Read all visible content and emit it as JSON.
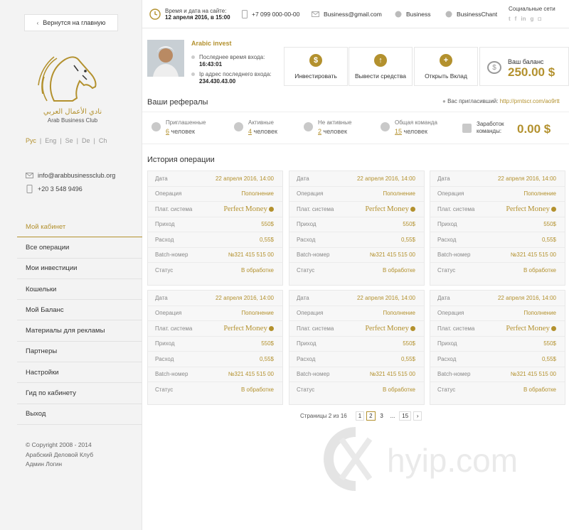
{
  "sidebar": {
    "back_label": "Вернутся на главную",
    "logo_text_ar": "نادي الأعمال العربي",
    "logo_text_en": "Arab Business Club",
    "languages": [
      "Рус",
      "Eng",
      "Se",
      "De",
      "Ch"
    ],
    "active_language": "Рус",
    "email": "info@arabbusinessclub.org",
    "phone": "+20 3 548 9496",
    "nav": [
      {
        "label": "Мой кабинет",
        "active": true
      },
      {
        "label": "Все операции"
      },
      {
        "label": "Мои инвестиции"
      },
      {
        "label": "Кошельки"
      },
      {
        "label": "Мой Баланс"
      },
      {
        "label": "Материалы для рекламы"
      },
      {
        "label": "Партнеры"
      },
      {
        "label": "Настройки"
      },
      {
        "label": "Гид по кабинету"
      },
      {
        "label": "Выход"
      }
    ],
    "copyright_line1": "© Copyright 2008 - 2014",
    "copyright_line2": "Арабский Деловой Клуб",
    "copyright_line3": "Админ Логин"
  },
  "topbar": {
    "datetime_label": "Время и дата на сайте:",
    "datetime_value": "12 апреля 2016, в 15:00",
    "phone": "+7 099 000-00-00",
    "email": "Business@gmail.com",
    "skype1": "Business",
    "skype2": "BusinessChant",
    "social_title": "Социальные сети",
    "social_icons": [
      "twitter-icon",
      "facebook-icon",
      "linkedin-icon",
      "google-icon",
      "instagram-icon"
    ]
  },
  "profile": {
    "name": "Arabic invest",
    "last_login_label": "Последнее время входа:",
    "last_login_value": "16:43:01",
    "ip_label": "Ip адрес последнего входа:",
    "ip_value": "234.430.43.00"
  },
  "actions": [
    {
      "label": "Инвестировать",
      "icon": "invest-icon"
    },
    {
      "label": "Вывести средства",
      "icon": "withdraw-icon"
    },
    {
      "label": "Открыть Вклад",
      "icon": "deposit-icon"
    }
  ],
  "balance": {
    "label": "Ваш баланс",
    "value": "250.00 $"
  },
  "referrals": {
    "title": "Ваши рефералы",
    "invited_by_label": "Вас пригласивший:",
    "invited_by_link": "http://prntscr.com/ao9rtt",
    "stats": [
      {
        "label": "Приглашенные",
        "count": "6",
        "unit": "человек"
      },
      {
        "label": "Активные",
        "count": "4",
        "unit": "человек"
      },
      {
        "label": "Не активные",
        "count": "2",
        "unit": "человек"
      },
      {
        "label": "Общая команда",
        "count": "15",
        "unit": "человек"
      }
    ],
    "earned_label_1": "Заработок",
    "earned_label_2": "команды:",
    "earned_value": "0.00 $"
  },
  "history": {
    "title": "История операции",
    "labels": {
      "date": "Дата",
      "operation": "Операция",
      "system": "Плат. система",
      "income": "Приход",
      "expense": "Расход",
      "batch": "Batch-номер",
      "status": "Статус"
    },
    "pm_word1": "Perfect",
    "pm_word2": "Money",
    "cards": [
      {
        "date": "22 апреля 2016, 14:00",
        "operation": "Пополнение",
        "income": "550$",
        "expense": "0,55$",
        "batch": "№321 415 515 00",
        "status": "В обработке"
      },
      {
        "date": "22 апреля 2016, 14:00",
        "operation": "Пополнение",
        "income": "550$",
        "expense": "0,55$",
        "batch": "№321 415 515 00",
        "status": "В обработке"
      },
      {
        "date": "22 апреля 2016, 14:00",
        "operation": "Пополнение",
        "income": "550$",
        "expense": "0,55$",
        "batch": "№321 415 515 00",
        "status": "В обработке"
      },
      {
        "date": "22 апреля 2016, 14:00",
        "operation": "Пополнение",
        "income": "550$",
        "expense": "0,55$",
        "batch": "№321 415 515 00",
        "status": "В обработке"
      },
      {
        "date": "22 апреля 2016, 14:00",
        "operation": "Пополнение",
        "income": "550$",
        "expense": "0,55$",
        "batch": "№321 415 515 00",
        "status": "В обработке"
      },
      {
        "date": "22 апреля 2016, 14:00",
        "operation": "Пополнение",
        "income": "550$",
        "expense": "0,55$",
        "batch": "№321 415 515 00",
        "status": "В обработке"
      }
    ]
  },
  "pager": {
    "text": "Страницы 2 из 16",
    "pages": [
      "1",
      "2",
      "3",
      "...",
      "15",
      "›"
    ],
    "current": "2"
  },
  "watermark": "hyip.com"
}
